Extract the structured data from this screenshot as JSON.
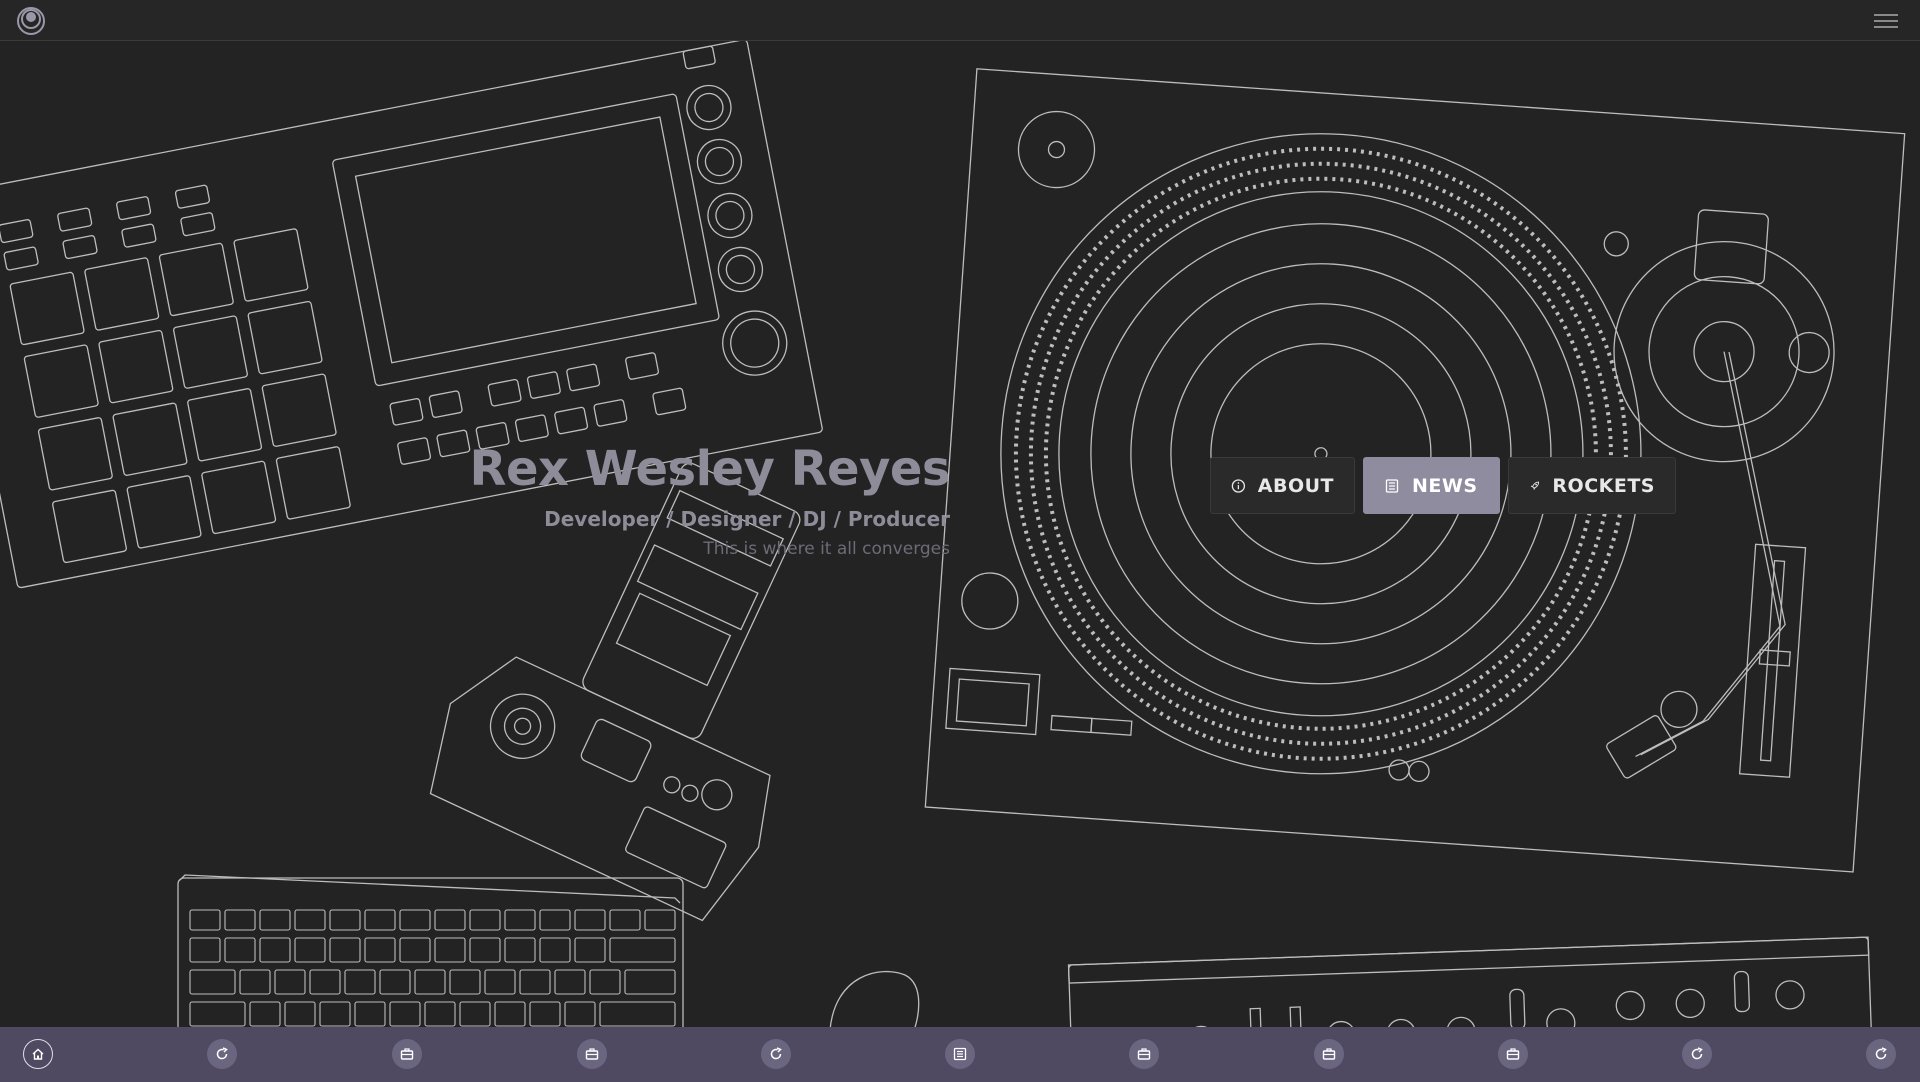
{
  "hero": {
    "name": "Rex Wesley Reyes",
    "roles": "Developer / Designer / DJ / Producer",
    "tagline": "This is where it all converges"
  },
  "nav": {
    "buttons": [
      {
        "label": "ABOUT",
        "icon": "info-icon",
        "active": false
      },
      {
        "label": "NEWS",
        "icon": "newspaper-icon",
        "active": true
      },
      {
        "label": "ROCKETS",
        "icon": "rocket-icon",
        "active": false
      }
    ]
  },
  "dock": {
    "items": [
      {
        "icon": "home-icon",
        "active": true
      },
      {
        "icon": "refresh-icon"
      },
      {
        "icon": "briefcase-icon"
      },
      {
        "icon": "briefcase-icon"
      },
      {
        "icon": "refresh-icon"
      },
      {
        "icon": "newspaper-icon"
      },
      {
        "icon": "briefcase-icon"
      },
      {
        "icon": "briefcase-icon"
      },
      {
        "icon": "briefcase-icon"
      },
      {
        "icon": "refresh-icon"
      },
      {
        "icon": "refresh-icon"
      }
    ]
  },
  "colors": {
    "background": "#232323",
    "topbar": "#262626",
    "accent": "#8f8c9f",
    "dock": "#4f4a62",
    "lineart": "#bdbdbd"
  }
}
